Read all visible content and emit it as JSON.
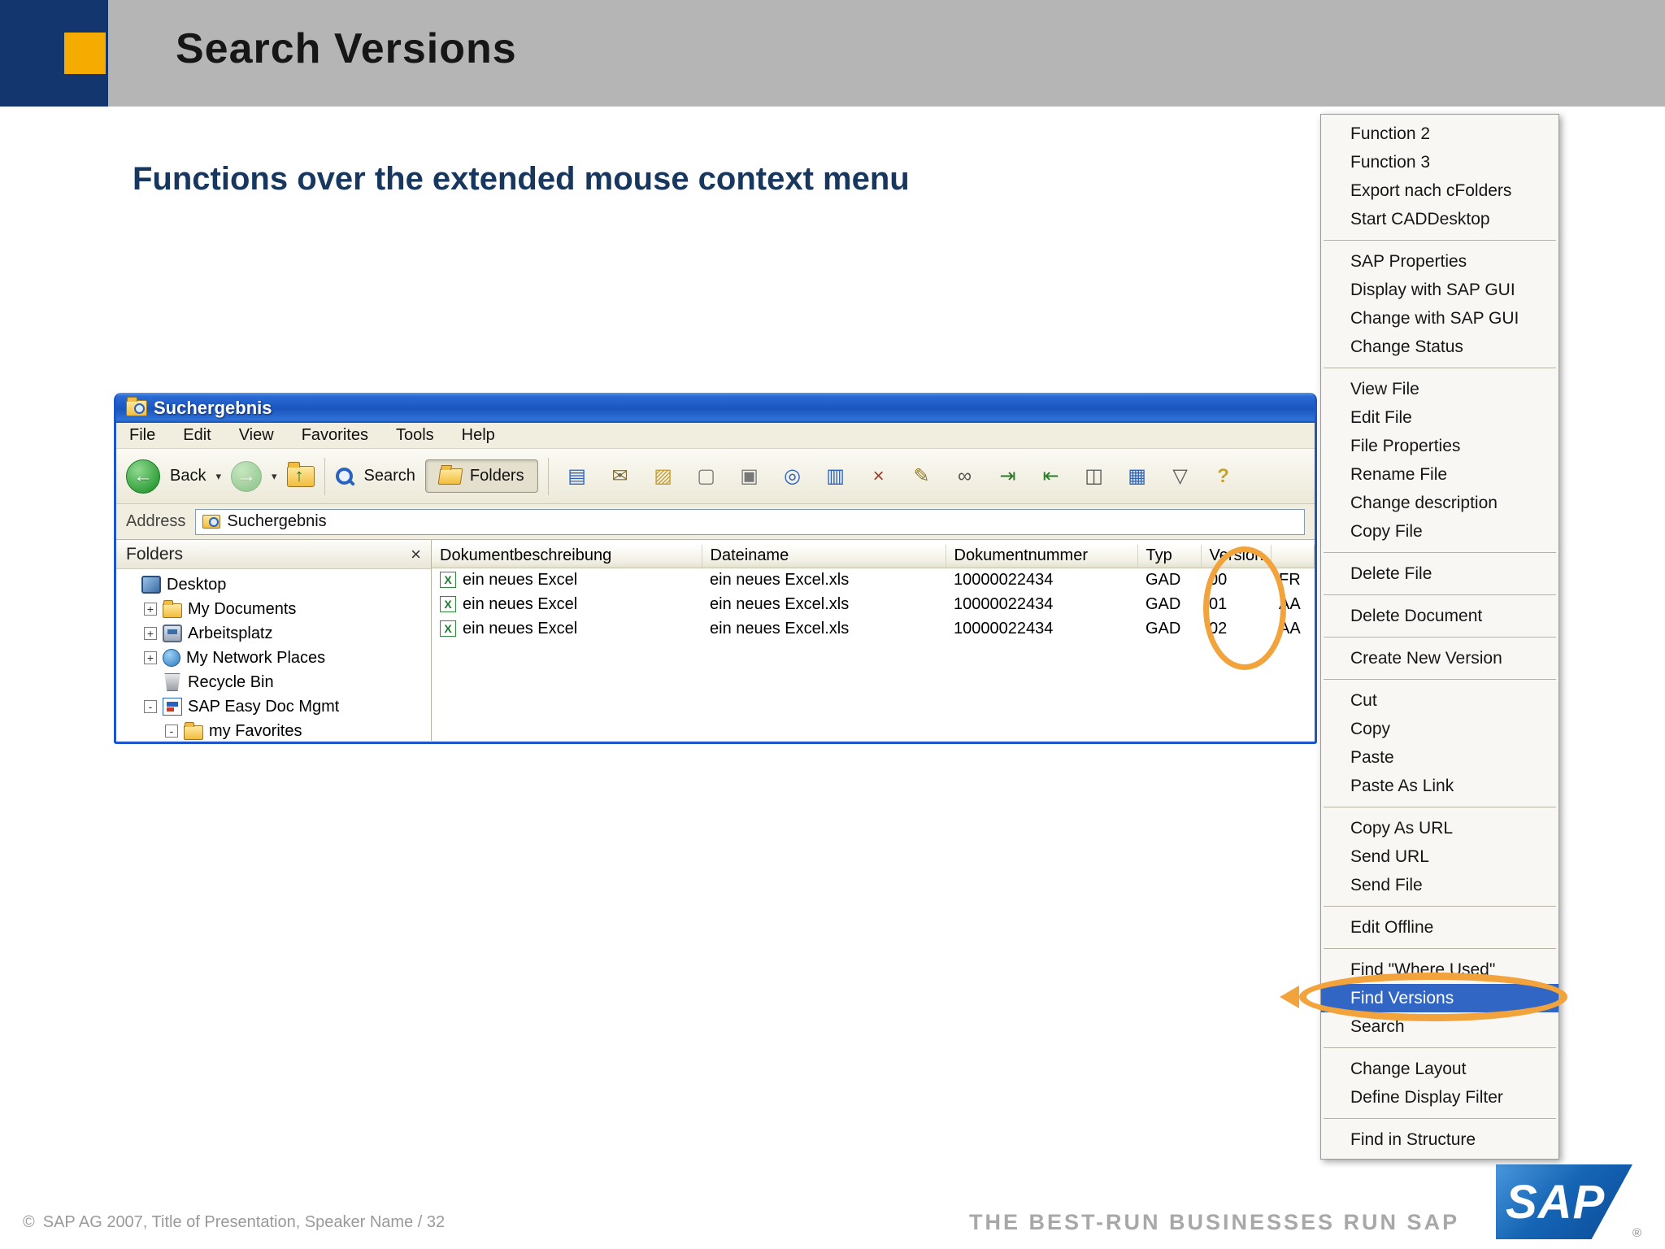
{
  "slide": {
    "title": "Search Versions",
    "subtitle": "Functions over the extended mouse context menu"
  },
  "window": {
    "title": "Suchergebnis",
    "menu_items": [
      "File",
      "Edit",
      "View",
      "Favorites",
      "Tools",
      "Help"
    ],
    "toolbar": {
      "back_label": "Back",
      "back_arrow": "←",
      "forward_arrow": "→",
      "dropdown_glyph": "▾",
      "search_label": "Search",
      "folders_label": "Folders",
      "icons": [
        "easy-doc-icon",
        "mail-icon",
        "new-folder-icon",
        "new-document-icon",
        "copy-document-icon",
        "preview-icon",
        "versions-icon",
        "delete-icon",
        "edit-icon",
        "link-icon",
        "checkout-icon",
        "checkin-icon",
        "save-icon",
        "layout-icon",
        "filter-icon",
        "help-icon"
      ]
    },
    "address_label": "Address",
    "address_value": "Suchergebnis",
    "folders_panel": {
      "title": "Folders",
      "close_glyph": "×",
      "tree": [
        {
          "label": "Desktop",
          "icon": "desktop-icon",
          "indent": 0,
          "expander": ""
        },
        {
          "label": "My Documents",
          "icon": "documents-folder-icon",
          "indent": 1,
          "expander": "+"
        },
        {
          "label": "Arbeitsplatz",
          "icon": "computer-icon",
          "indent": 1,
          "expander": "+"
        },
        {
          "label": "My Network Places",
          "icon": "network-icon",
          "indent": 1,
          "expander": "+"
        },
        {
          "label": "Recycle Bin",
          "icon": "recycle-icon",
          "indent": 1,
          "expander": ""
        },
        {
          "label": "SAP Easy Doc Mgmt",
          "icon": "sapdoc-icon",
          "indent": 1,
          "expander": "-"
        },
        {
          "label": "my Favorites",
          "icon": "favorites-folder-icon",
          "indent": 2,
          "expander": "-"
        }
      ]
    },
    "table": {
      "columns": [
        "Dokumentbeschreibung",
        "Dateiname",
        "Dokumentnummer",
        "Typ",
        "Version",
        ""
      ],
      "rows": [
        [
          "ein neues Excel",
          "ein neues Excel.xls",
          "10000022434",
          "GAD",
          "00",
          "FR"
        ],
        [
          "ein neues Excel",
          "ein neues Excel.xls",
          "10000022434",
          "GAD",
          "01",
          "AA"
        ],
        [
          "ein neues Excel",
          "ein neues Excel.xls",
          "10000022434",
          "GAD",
          "02",
          "AA"
        ]
      ]
    }
  },
  "context_menu": {
    "groups": [
      {
        "items": [
          {
            "label": "Function 2"
          },
          {
            "label": "Function 3"
          },
          {
            "label": "Export nach cFolders"
          },
          {
            "label": "Start CADDesktop"
          }
        ]
      },
      {
        "items": [
          {
            "label": "SAP Properties"
          },
          {
            "label": "Display with SAP GUI"
          },
          {
            "label": "Change with SAP GUI"
          },
          {
            "label": "Change Status"
          }
        ]
      },
      {
        "items": [
          {
            "label": "View File"
          },
          {
            "label": "Edit File"
          },
          {
            "label": "File Properties"
          },
          {
            "label": "Rename File"
          },
          {
            "label": "Change description"
          },
          {
            "label": "Copy File"
          }
        ]
      },
      {
        "items": [
          {
            "label": "Delete File"
          }
        ]
      },
      {
        "items": [
          {
            "label": "Delete Document"
          }
        ]
      },
      {
        "items": [
          {
            "label": "Create New Version"
          }
        ]
      },
      {
        "items": [
          {
            "label": "Cut"
          },
          {
            "label": "Copy"
          },
          {
            "label": "Paste"
          },
          {
            "label": "Paste As Link"
          }
        ]
      },
      {
        "items": [
          {
            "label": "Copy As URL"
          },
          {
            "label": "Send URL"
          },
          {
            "label": "Send File"
          }
        ]
      },
      {
        "items": [
          {
            "label": "Edit Offline"
          }
        ]
      },
      {
        "items": [
          {
            "label": "Find \"Where Used\""
          },
          {
            "label": "Find Versions",
            "highlighted": true
          },
          {
            "label": "Search"
          }
        ]
      },
      {
        "items": [
          {
            "label": "Change Layout"
          },
          {
            "label": "Define Display Filter"
          }
        ]
      },
      {
        "items": [
          {
            "label": "Find in Structure"
          }
        ]
      }
    ]
  },
  "footer": {
    "copyright_symbol": "©",
    "copyright_text": "SAP AG 2007, Title of Presentation, Speaker Name / 32",
    "tagline": "THE BEST-RUN BUSINESSES RUN SAP",
    "logo_text": "SAP",
    "logo_reg": "®"
  },
  "colors": {
    "accent_orange": "#F2A33C",
    "highlight_blue": "#3166C5",
    "sap_navy": "#14366E",
    "sap_gold": "#F5AB00"
  }
}
